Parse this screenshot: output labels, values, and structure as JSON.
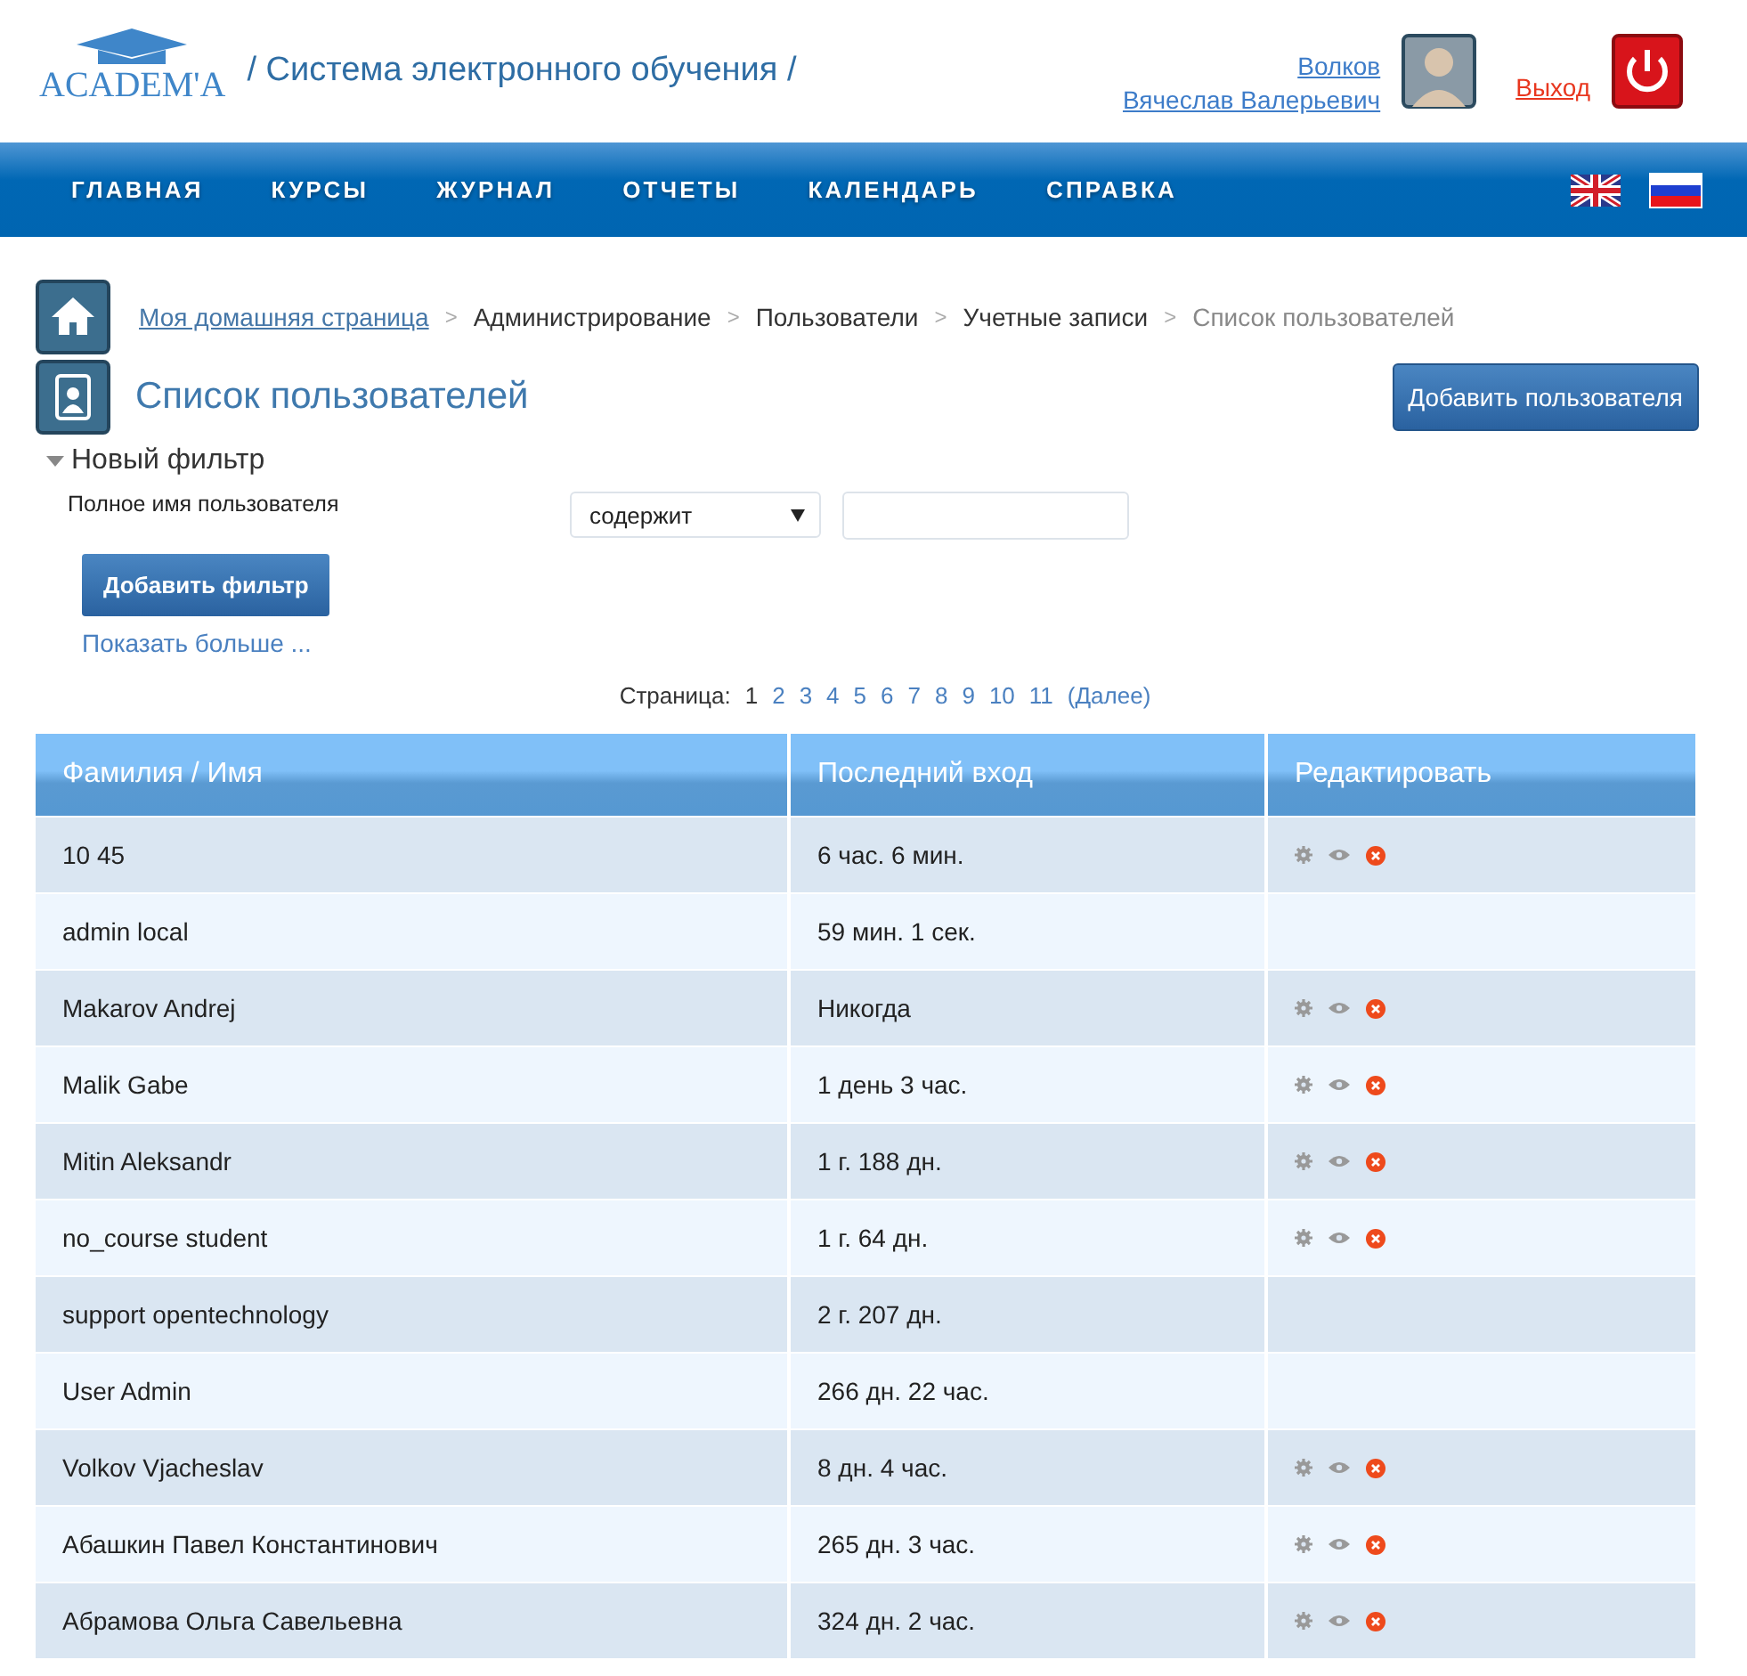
{
  "header": {
    "logo_text": "ACADEM'A",
    "site_title": "/ Система электронного обучения /",
    "user_last_name": "Волков",
    "user_first_names": "Вячеслав Валерьевич",
    "logout": "Выход"
  },
  "nav": {
    "items": [
      {
        "label": "ГЛАВНАЯ"
      },
      {
        "label": "КУРСЫ"
      },
      {
        "label": "ЖУРНАЛ"
      },
      {
        "label": "ОТЧЕТЫ"
      },
      {
        "label": "КАЛЕНДАРЬ"
      },
      {
        "label": "СПРАВКА"
      }
    ],
    "languages": [
      {
        "kind": "uk"
      },
      {
        "kind": "ru"
      }
    ]
  },
  "breadcrumbs": [
    {
      "label": "Моя домашняя страница",
      "link": true,
      "current": false
    },
    {
      "label": "Администрирование",
      "link": false,
      "current": false
    },
    {
      "label": "Пользователи",
      "link": false,
      "current": false
    },
    {
      "label": "Учетные записи",
      "link": false,
      "current": false
    },
    {
      "label": "Список пользователей",
      "link": false,
      "current": true
    }
  ],
  "breadcrumb_separator": ">",
  "page_title": "Список пользователей",
  "add_user_button": "Добавить пользователя",
  "filter": {
    "title": "Новый фильтр",
    "expanded": true,
    "field_label": "Полное имя пользователя",
    "operator": "содержит",
    "add_button": "Добавить фильтр",
    "show_more": "Показать больше ..."
  },
  "pagination": {
    "label": "Страница:",
    "pages": [
      {
        "label": "1",
        "selected": true
      },
      {
        "label": "2",
        "selected": false
      },
      {
        "label": "3",
        "selected": false
      },
      {
        "label": "4",
        "selected": false
      },
      {
        "label": "5",
        "selected": false
      },
      {
        "label": "6",
        "selected": false
      },
      {
        "label": "7",
        "selected": false
      },
      {
        "label": "8",
        "selected": false
      },
      {
        "label": "9",
        "selected": false
      },
      {
        "label": "10",
        "selected": false
      },
      {
        "label": "11",
        "selected": false
      }
    ],
    "next": "(Далее)"
  },
  "table": {
    "columns": [
      "Фамилия / Имя",
      "Последний вход",
      "Редактировать"
    ],
    "rows": [
      {
        "name": "10 45",
        "last_login": "6 час. 6 мин.",
        "actions": true
      },
      {
        "name": "admin local",
        "last_login": "59 мин. 1 сек.",
        "actions": false
      },
      {
        "name": "Makarov Andrej",
        "last_login": "Никогда",
        "actions": true
      },
      {
        "name": "Malik Gabe",
        "last_login": "1 день 3 час.",
        "actions": true
      },
      {
        "name": "Mitin Aleksandr",
        "last_login": "1 г. 188 дн.",
        "actions": true
      },
      {
        "name": "no_course student",
        "last_login": "1 г. 64 дн.",
        "actions": true
      },
      {
        "name": "support opentechnology",
        "last_login": "2 г. 207 дн.",
        "actions": false
      },
      {
        "name": "User Admin",
        "last_login": "266 дн. 22 час.",
        "actions": false
      },
      {
        "name": "Volkov Vjacheslav",
        "last_login": "8 дн. 4 час.",
        "actions": true
      },
      {
        "name": "Абашкин Павел Константинович",
        "last_login": "265 дн. 3 час.",
        "actions": true
      },
      {
        "name": "Абрамова Ольга Савельевна",
        "last_login": "324 дн. 2 час.",
        "actions": true
      }
    ]
  }
}
